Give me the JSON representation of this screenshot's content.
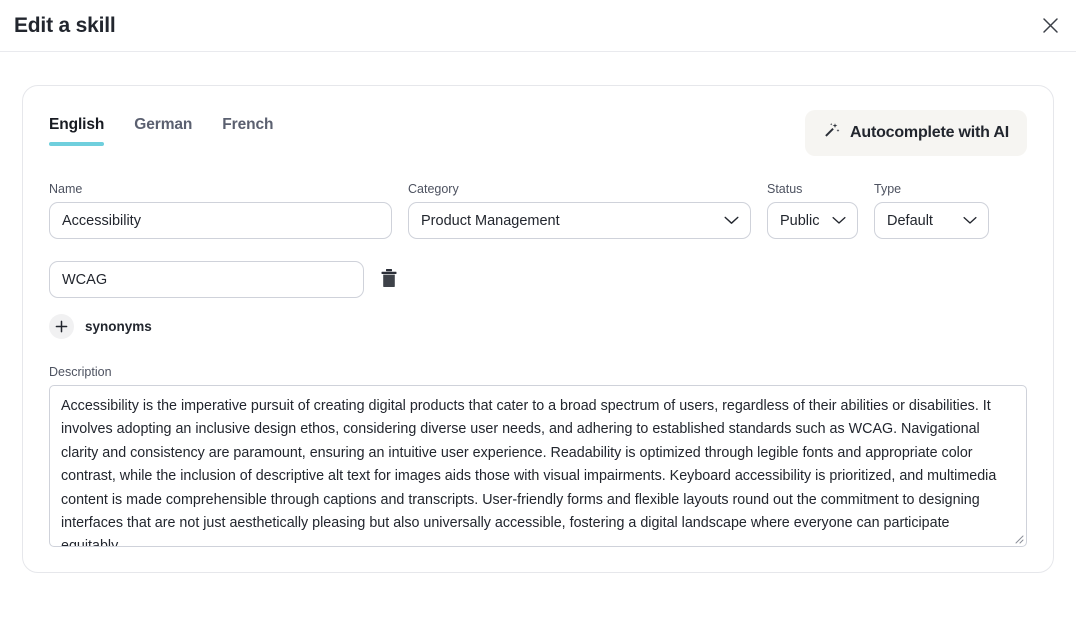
{
  "header": {
    "title": "Edit a skill",
    "close_icon": "close-icon"
  },
  "tabs": [
    {
      "label": "English",
      "active": true
    },
    {
      "label": "German",
      "active": false
    },
    {
      "label": "French",
      "active": false
    }
  ],
  "autocomplete_button": {
    "label": "Autocomplete with AI",
    "icon": "magic-wand-icon",
    "background": "#f6f5f2"
  },
  "fields": {
    "name": {
      "label": "Name",
      "value": "Accessibility",
      "placeholder": "Name"
    },
    "category": {
      "label": "Category",
      "value": "Product Management",
      "icon": "chevron-down-icon"
    },
    "status": {
      "label": "Status",
      "value": "Public",
      "icon": "chevron-down-icon"
    },
    "type": {
      "label": "Type",
      "value": "Default",
      "icon": "chevron-down-icon"
    }
  },
  "synonyms": {
    "rows": [
      {
        "value": "WCAG",
        "placeholder": "Synonym",
        "delete_icon": "trash-icon"
      }
    ],
    "add_label": "synonyms",
    "add_icon": "plus-icon"
  },
  "description": {
    "label": "Description",
    "value": "Accessibility is the imperative pursuit of creating digital products that cater to a broad spectrum of users, regardless of their abilities or disabilities. It involves adopting an inclusive design ethos, considering diverse user needs, and adhering to established standards such as WCAG. Navigational clarity and consistency are paramount, ensuring an intuitive user experience. Readability is optimized through legible fonts and appropriate color contrast, while the inclusion of descriptive alt text for images aids those with visual impairments. Keyboard accessibility is prioritized, and multimedia content is made comprehensible through captions and transcripts. User-friendly forms and flexible layouts round out the commitment to designing interfaces that are not just aesthetically pleasing but also universally accessible, fostering a digital landscape where everyone can participate equitably.",
    "placeholder": "Description",
    "resize_handle": "resize-grip-icon"
  },
  "colors": {
    "accent_teal": "#6fcfdd",
    "border": "#cfd2da",
    "card_border": "#e6e7eb",
    "text": "#22262e",
    "muted_text": "#4d5260"
  }
}
